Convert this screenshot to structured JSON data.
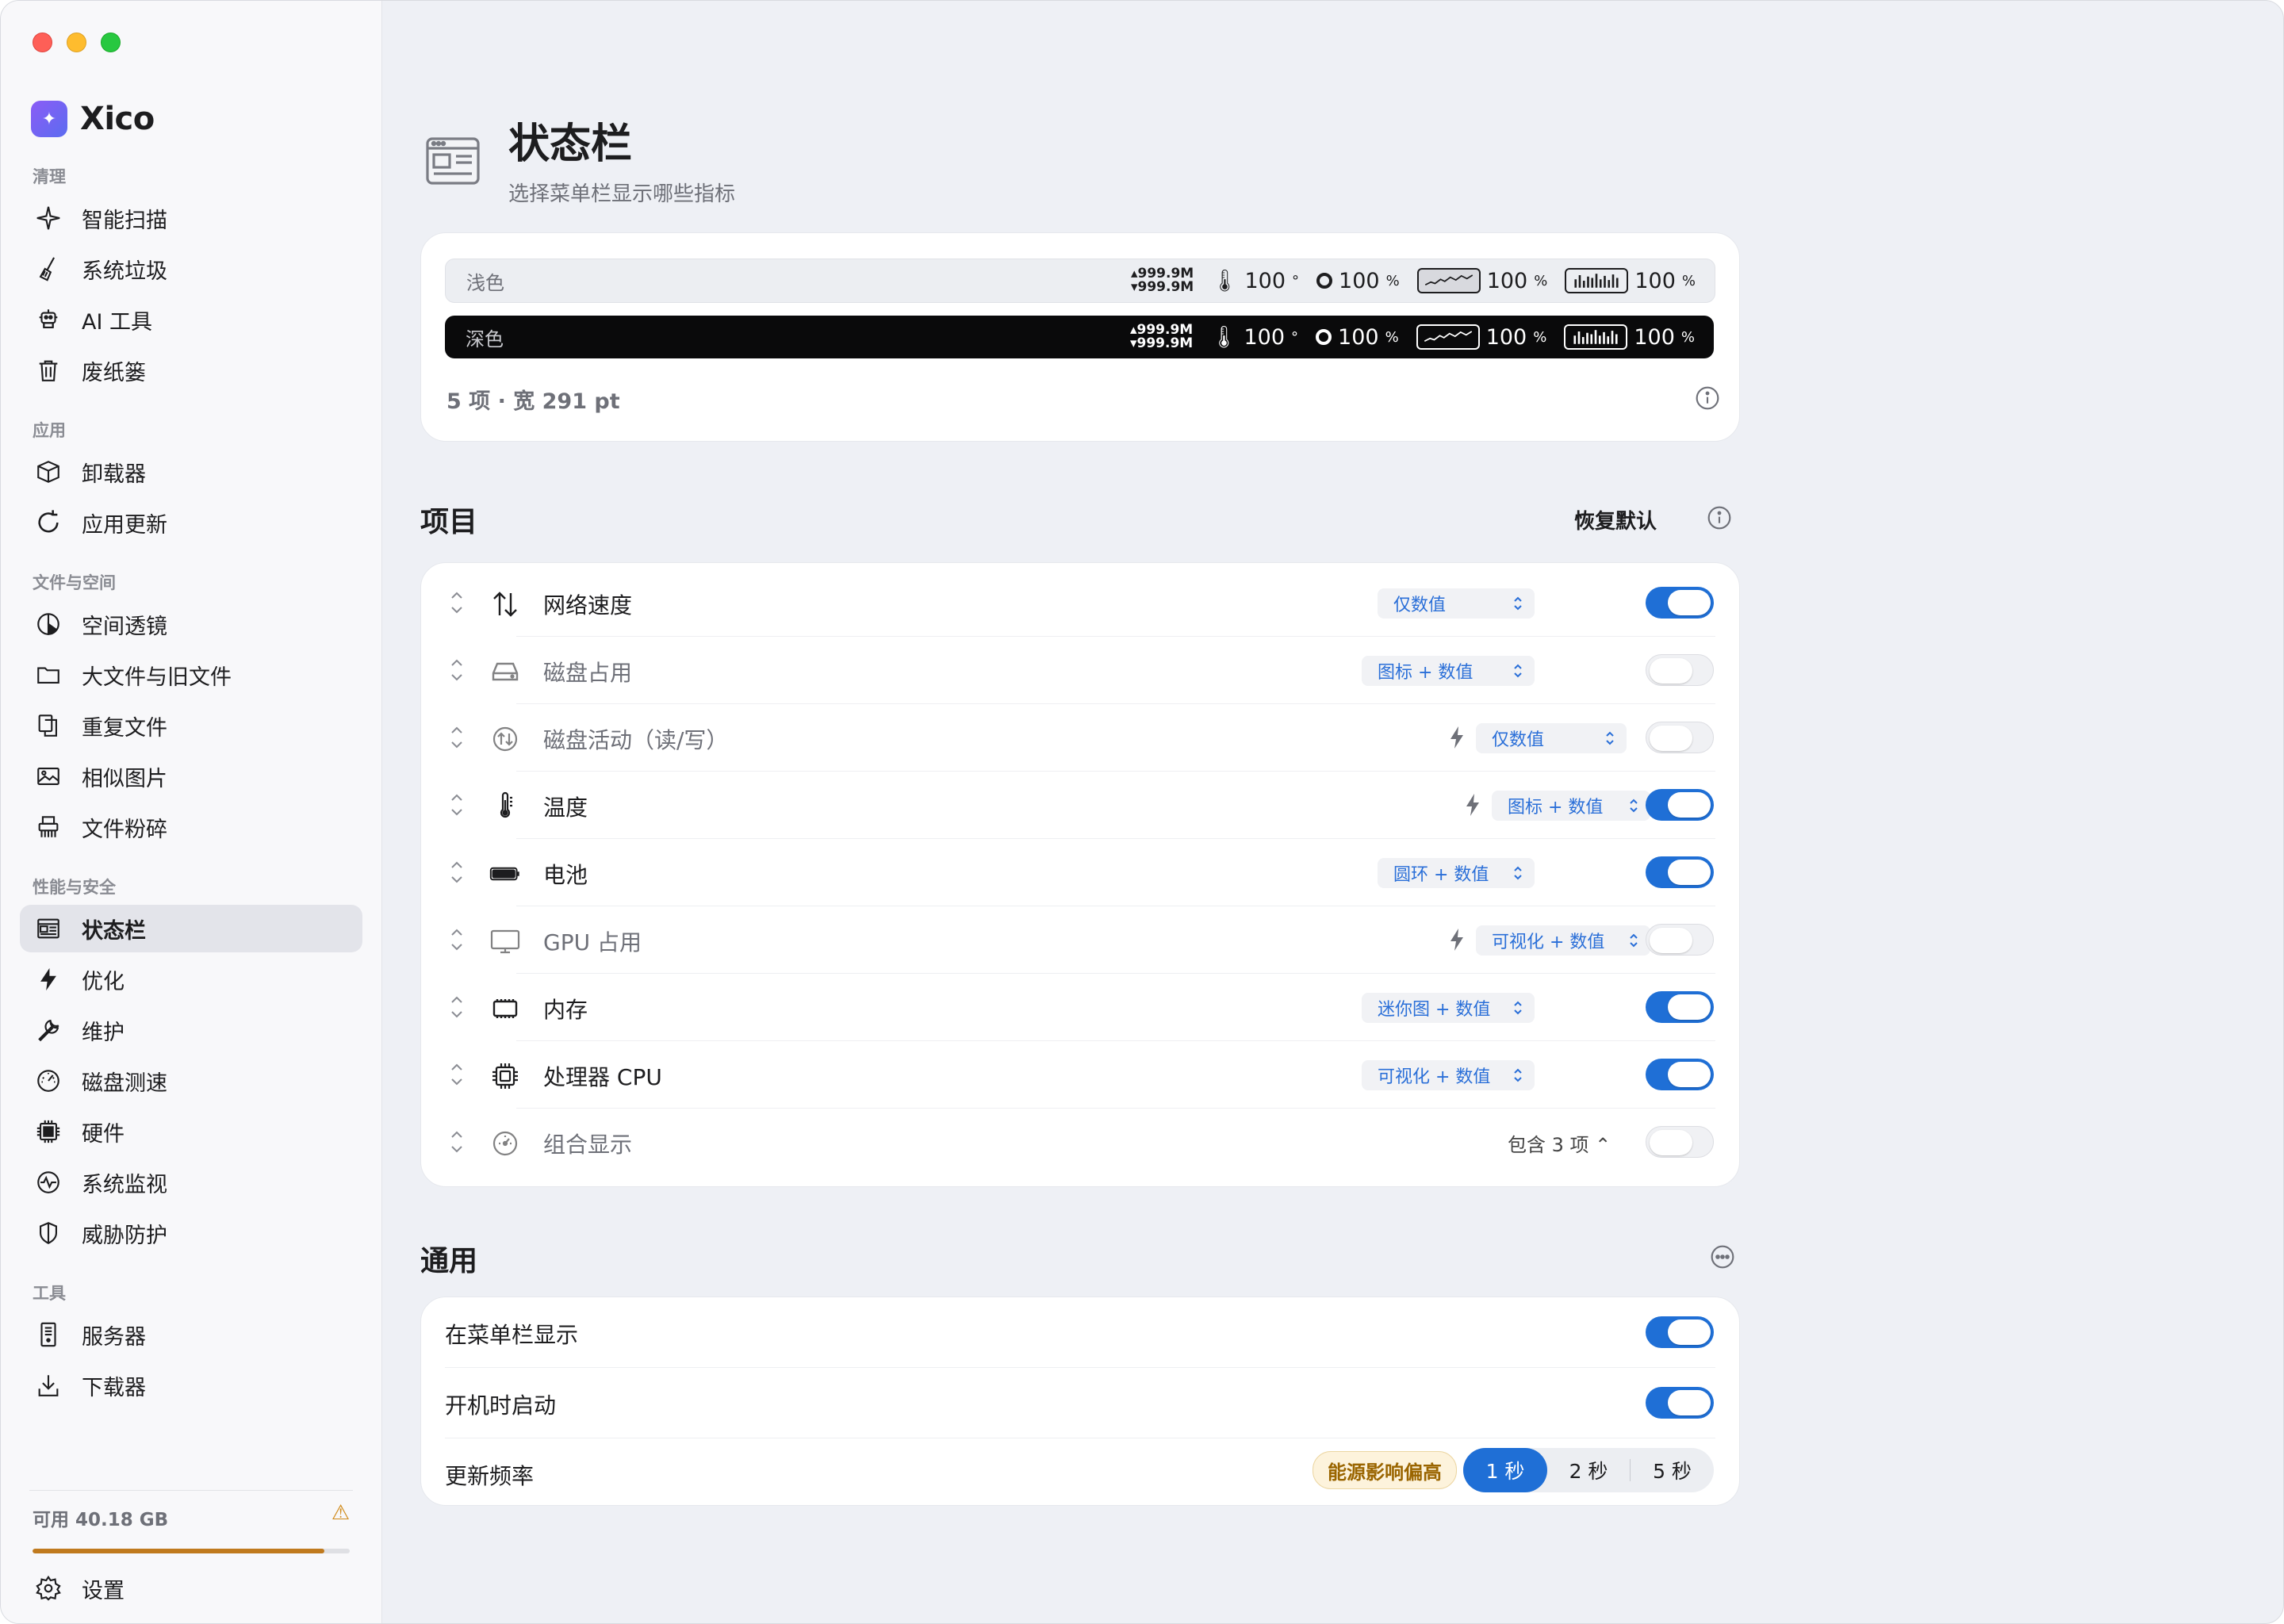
{
  "app": {
    "name": "Xico"
  },
  "sidebar": {
    "sections": [
      {
        "title": "清理",
        "items": [
          "智能扫描",
          "系统垃圾",
          "AI 工具",
          "废纸篓"
        ]
      },
      {
        "title": "应用",
        "items": [
          "卸载器",
          "应用更新"
        ]
      },
      {
        "title": "文件与空间",
        "items": [
          "空间透镜",
          "大文件与旧文件",
          "重复文件",
          "相似图片",
          "文件粉碎"
        ]
      },
      {
        "title": "性能与安全",
        "items": [
          "状态栏",
          "优化",
          "维护",
          "磁盘测速",
          "硬件",
          "系统监视",
          "威胁防护"
        ]
      },
      {
        "title": "工具",
        "items": [
          "服务器",
          "下载器"
        ]
      }
    ],
    "active_item": "状态栏",
    "storage": {
      "text": "可用 40.18 GB",
      "used_fraction": 0.92
    },
    "settings_label": "设置"
  },
  "page": {
    "title": "状态栏",
    "subtitle": "选择菜单栏显示哪些指标"
  },
  "preview": {
    "light_label": "浅色",
    "dark_label": "深色",
    "net_up": "999.9M",
    "net_down": "999.9M",
    "temp": "100",
    "temp_unit": "°",
    "battery": "100",
    "gpu": "100",
    "cpu": "100",
    "percent": "%",
    "summary": "5 项 · 宽 291 pt"
  },
  "items_section": {
    "title": "项目",
    "restore_label": "恢复默认",
    "items": [
      {
        "name": "网络速度",
        "mode": "仅数值",
        "enabled": true,
        "power": false
      },
      {
        "name": "磁盘占用",
        "mode": "图标 + 数值",
        "enabled": false,
        "power": false
      },
      {
        "name": "磁盘活动（读/写）",
        "mode": "仅数值",
        "enabled": false,
        "power": true
      },
      {
        "name": "温度",
        "mode": "图标 + 数值",
        "enabled": true,
        "power": true
      },
      {
        "name": "电池",
        "mode": "圆环 + 数值",
        "enabled": true,
        "power": false
      },
      {
        "name": "GPU 占用",
        "mode": "可视化 + 数值",
        "enabled": false,
        "power": true
      },
      {
        "name": "内存",
        "mode": "迷你图 + 数值",
        "enabled": true,
        "power": false
      },
      {
        "name": "处理器 CPU",
        "mode": "可视化 + 数值",
        "enabled": true,
        "power": false
      },
      {
        "name": "组合显示",
        "mode": "包含 3 项",
        "enabled": false,
        "power": false
      }
    ]
  },
  "general_section": {
    "title": "通用",
    "show_in_menubar_label": "在菜单栏显示",
    "show_in_menubar": true,
    "launch_at_login_label": "开机时启动",
    "launch_at_login": true,
    "update_freq_label": "更新频率",
    "energy_badge": "能源影响偏高",
    "freq_options": [
      "1 秒",
      "2 秒",
      "5 秒"
    ],
    "freq_selected": "1 秒"
  },
  "colors": {
    "accent": "#1f6fd6",
    "warning": "#c07a1e",
    "energy_badge_text": "#9a6500"
  }
}
